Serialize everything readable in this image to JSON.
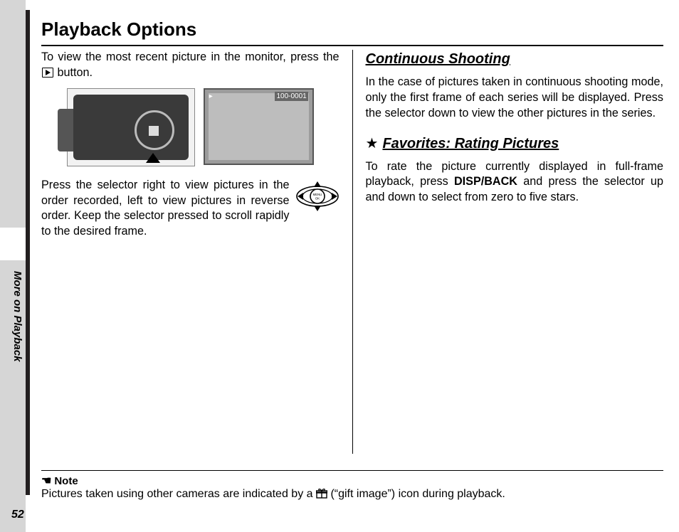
{
  "page": {
    "number": "52",
    "section": "More on Playback",
    "title": "Playback Options"
  },
  "left": {
    "p1a": "To view the most recent picture in the monitor, press the ",
    "p1b": " button.",
    "photo_counter": "100-0001",
    "p2": "Press the selector right to view pictures in the order recorded, left to view pictures in reverse order.  Keep the selector pressed to scroll rapidly to the desired frame.",
    "selector_label": "MENU OK"
  },
  "right": {
    "h1": "Continuous Shooting",
    "p1": "In the case of pictures taken in continuous shooting mode, only the first frame of each series will be displayed.  Press the selector down to view the other pictures in the series.",
    "h2": " Favorites: Rating Pictures",
    "star": "★",
    "p2a": "To rate the picture currently displayed in full-frame playback, press ",
    "disp": "DISP/BACK",
    "p2b": " and press the selector up and down to select from zero to five stars."
  },
  "note": {
    "hand": "☚",
    "label": "Note",
    "text_a": "Pictures taken using other cameras are indicated by a ",
    "gift_label": "gift image",
    "text_b": " (“gift image”) icon during playback."
  }
}
